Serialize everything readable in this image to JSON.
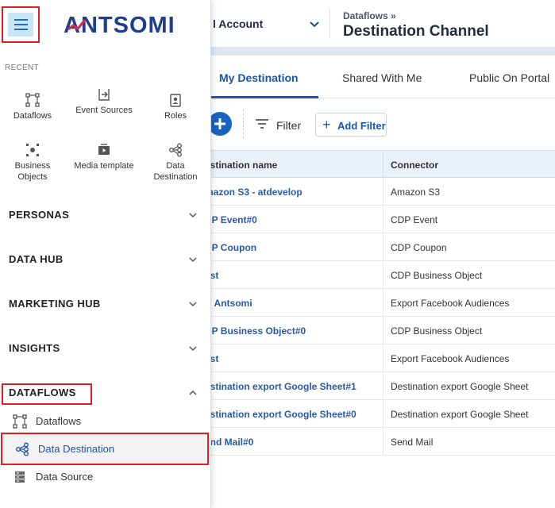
{
  "header": {
    "account_label": "l Account",
    "breadcrumb": "Dataflows »",
    "title": "Destination Channel"
  },
  "tabs": [
    {
      "label": "My Destination",
      "active": true
    },
    {
      "label": "Shared With Me",
      "active": false
    },
    {
      "label": "Public On Portal",
      "active": false
    }
  ],
  "toolbar": {
    "filter_label": "Filter",
    "add_filter_label": "Add Filter"
  },
  "table": {
    "columns": [
      "estination name",
      "Connector"
    ],
    "rows": [
      {
        "name": "mazon S3 - atdevelop",
        "connector": "Amazon S3"
      },
      {
        "name": "DP Event#0",
        "connector": "CDP Event"
      },
      {
        "name": "DP Coupon",
        "connector": "CDP Coupon"
      },
      {
        "name": "est",
        "connector": "CDP Business Object"
      },
      {
        "name": "B Antsomi",
        "connector": "Export Facebook Audiences"
      },
      {
        "name": "DP Business Object#0",
        "connector": "CDP Business Object"
      },
      {
        "name": "est",
        "connector": "Export Facebook Audiences"
      },
      {
        "name": "estination export Google Sheet#1",
        "connector": "Destination export Google Sheet"
      },
      {
        "name": "estination export Google Sheet#0",
        "connector": "Destination export Google Sheet"
      },
      {
        "name": "end Mail#0",
        "connector": "Send Mail"
      }
    ]
  },
  "sidebar": {
    "logo_text": "ANTSOMI",
    "recent_label": "RECENT",
    "recent_items": [
      {
        "label": "Dataflows",
        "icon": "dataflow-icon"
      },
      {
        "label": "Event Sources",
        "icon": "event-source-icon"
      },
      {
        "label": "Roles",
        "icon": "badge-icon"
      },
      {
        "label": "Business Objects",
        "icon": "business-objects-icon"
      },
      {
        "label": "Media template",
        "icon": "media-icon"
      },
      {
        "label": "Data Destination",
        "icon": "share-icon"
      }
    ],
    "sections": [
      {
        "label": "PERSONAS",
        "expanded": false
      },
      {
        "label": "DATA HUB",
        "expanded": false
      },
      {
        "label": "MARKETING HUB",
        "expanded": false
      },
      {
        "label": "INSIGHTS",
        "expanded": false
      },
      {
        "label": "DATAFLOWS",
        "expanded": true
      }
    ],
    "dataflow_items": [
      {
        "label": "Dataflows",
        "icon": "dataflow-icon",
        "active": false
      },
      {
        "label": "Data Destination",
        "icon": "share-icon",
        "active": true
      },
      {
        "label": "Data Source",
        "icon": "database-icon",
        "active": false
      }
    ]
  },
  "colors": {
    "accent": "#1a56a8",
    "highlight": "#e02020",
    "table_header_bg": "#e9f1fa"
  }
}
